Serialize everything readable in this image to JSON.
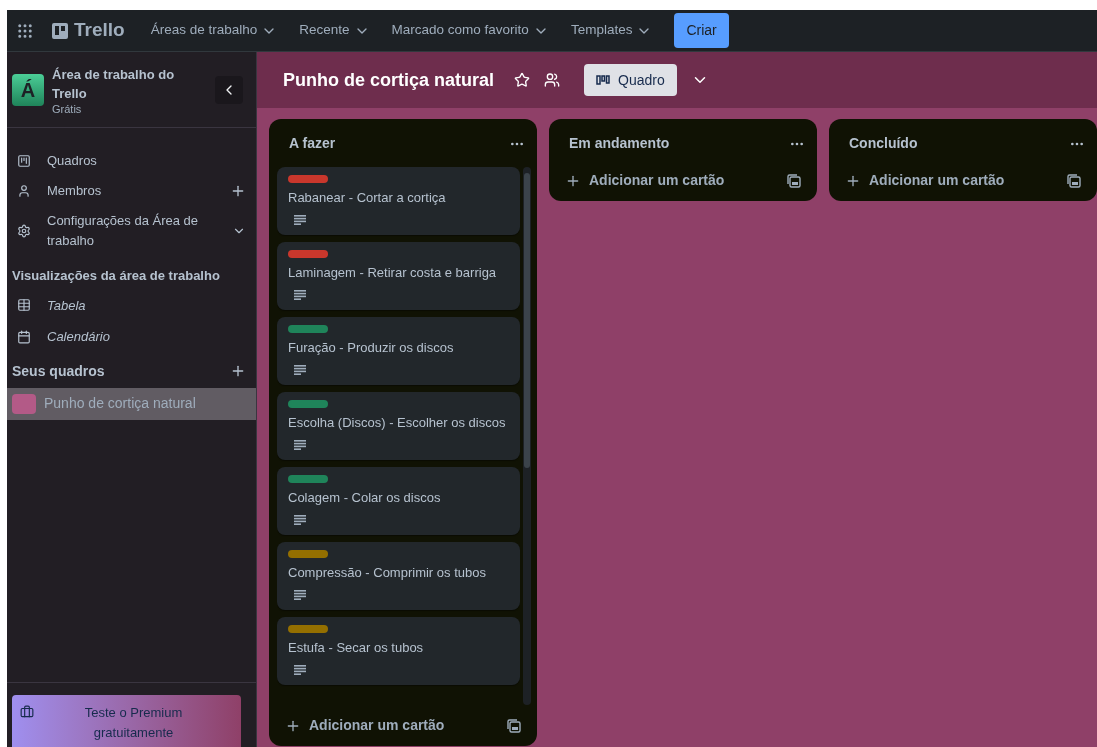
{
  "topbar": {
    "logo": "Trello",
    "menus": [
      "Áreas de trabalho",
      "Recente",
      "Marcado como favorito",
      "Templates"
    ],
    "create_button": "Criar"
  },
  "sidebar": {
    "workspace": {
      "initial": "Á",
      "name": "Área de trabalho do Trello",
      "plan": "Grátis"
    },
    "items": [
      {
        "label": "Quadros",
        "kind": "boards"
      },
      {
        "label": "Membros",
        "kind": "members"
      },
      {
        "label": "Configurações da Área de trabalho",
        "kind": "settings"
      }
    ],
    "views_title": "Visualizações da área de trabalho",
    "views": [
      {
        "label": "Tabela",
        "kind": "table"
      },
      {
        "label": "Calendário",
        "kind": "calendar"
      }
    ],
    "boards_title": "Seus quadros",
    "boards": [
      {
        "label": "Punho de cortiça natural",
        "color": "#b35a87",
        "selected": true
      }
    ],
    "premium": "Teste o Premium gratuitamente"
  },
  "board": {
    "title": "Punho de cortiça natural",
    "view": "Quadro",
    "lists": [
      {
        "title": "A fazer",
        "add_card": "Adicionar um cartão",
        "cards": [
          {
            "title": "Rabanear - Cortar a cortiça",
            "color": "#c9372c"
          },
          {
            "title": "Laminagem - Retirar costa e barriga",
            "color": "#c9372c"
          },
          {
            "title": "Furação - Produzir os discos",
            "color": "#1f845a"
          },
          {
            "title": "Escolha (Discos) - Escolher os discos",
            "color": "#1f845a"
          },
          {
            "title": "Colagem - Colar os discos",
            "color": "#1f845a"
          },
          {
            "title": "Compressão - Comprimir os tubos",
            "color": "#946f00"
          },
          {
            "title": "Estufa - Secar os tubos",
            "color": "#946f00"
          }
        ]
      },
      {
        "title": "Em andamento",
        "add_card": "Adicionar um cartão"
      },
      {
        "title": "Concluído",
        "add_card": "Adicionar um cartão"
      }
    ]
  }
}
